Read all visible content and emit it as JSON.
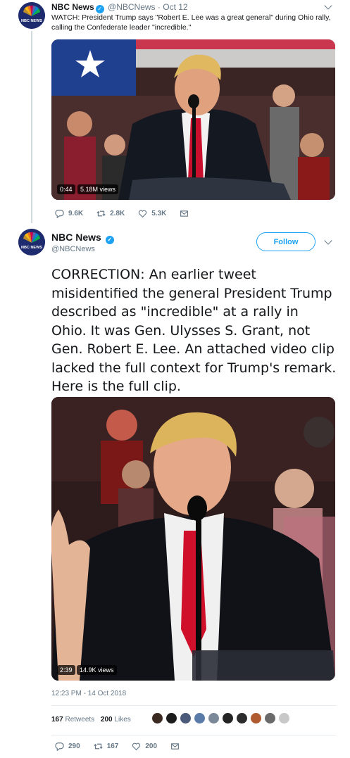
{
  "tweet1": {
    "name": "NBC News",
    "handle": "@NBCNews",
    "date": "· Oct 12",
    "text": "WATCH: President Trump says \"Robert E. Lee was a great general\" during Ohio rally, calling the Confederate leader \"incredible.\"",
    "video": {
      "time": "0:44",
      "views": "5.18M views"
    },
    "actions": {
      "replies": "9.6K",
      "retweets": "2.8K",
      "likes": "5.3K"
    }
  },
  "tweet2": {
    "name": "NBC News",
    "handle": "@NBCNews",
    "follow_label": "Follow",
    "text": "CORRECTION: An earlier tweet misidentified the general President Trump described as \"incredible\" at a rally in Ohio. It was Gen. Ulysses S. Grant, not Gen. Robert E. Lee. An attached video clip lacked the full context for Trump's remark. Here is the full clip.",
    "video": {
      "time": "2:39",
      "views": "14.9K views"
    },
    "timestamp": "12:23 PM - 14 Oct 2018",
    "retweets_count": "167",
    "retweets_label": "Retweets",
    "likes_count": "200",
    "likes_label": "Likes",
    "liker_colors": [
      "#3a2a22",
      "#1c1c1c",
      "#4a5a78",
      "#5a7aa8",
      "#7a8898",
      "#242424",
      "#2c2c2c",
      "#b05a30",
      "#6a6a6a",
      "#c8c8c8"
    ],
    "actions": {
      "replies": "290",
      "retweets": "167",
      "likes": "200"
    }
  },
  "colors": {
    "accent": "#1da1f2",
    "muted": "#657786",
    "text": "#14171a"
  },
  "icons": [
    "nbc-peacock-logo",
    "verified-badge-icon",
    "chevron-down-icon",
    "reply-icon",
    "retweet-icon",
    "like-icon",
    "message-icon"
  ]
}
